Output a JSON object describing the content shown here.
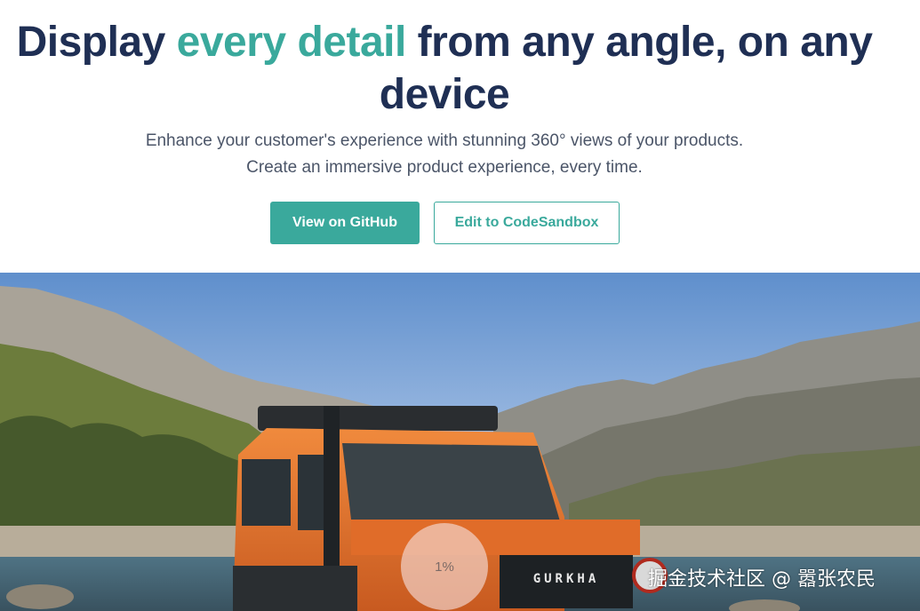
{
  "hero": {
    "headline_part1": "Display ",
    "headline_accent": "every detail",
    "headline_part2": " from any angle, on any device",
    "subtitle_line1": "Enhance your customer's experience with stunning 360° views of your products.",
    "subtitle_line2": "Create an immersive product experience, every time.",
    "primary_button": "View on GitHub",
    "secondary_button": "Edit to CodeSandbox"
  },
  "viewer": {
    "vehicle_plate": "GURKHA",
    "loading_progress": "1%",
    "loading_progress_value": 0.01
  },
  "watermark": "掘金技术社区 @ 嚣张农民",
  "colors": {
    "headline": "#1f2f54",
    "accent": "#3aa99c",
    "subtitle": "#4b5568",
    "vehicle_body": "#e5722e"
  }
}
